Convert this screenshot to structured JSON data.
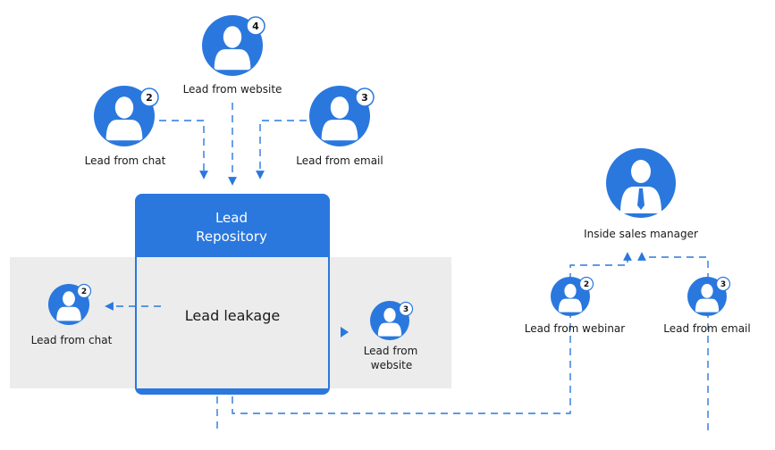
{
  "colors": {
    "accent": "#2a78de",
    "band": "#ececec"
  },
  "top_sources": {
    "website": {
      "label": "Lead from website",
      "count": "4",
      "icon": "person-icon"
    },
    "chat": {
      "label": "Lead from chat",
      "count": "2",
      "icon": "person-icon"
    },
    "email": {
      "label": "Lead from email",
      "count": "3",
      "icon": "person-icon"
    }
  },
  "repository": {
    "title_line1": "Lead",
    "title_line2": "Repository",
    "body": "Lead leakage"
  },
  "leaked": {
    "chat": {
      "label": "Lead from chat",
      "count": "2"
    },
    "website": {
      "label_line1": "Lead from",
      "label_line2": "website",
      "count": "3"
    }
  },
  "manager": {
    "label": "Inside sales manager",
    "icon": "manager-icon"
  },
  "routed": {
    "webinar": {
      "label": "Lead from webinar",
      "count": "2"
    },
    "email": {
      "label": "Lead from email",
      "count": "3"
    }
  }
}
